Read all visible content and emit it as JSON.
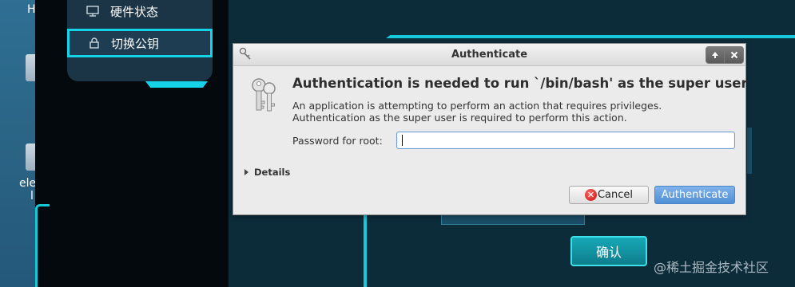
{
  "desktop": {
    "label_h": "H",
    "label_ele": "ele",
    "label_l": "l"
  },
  "sidebar": {
    "items": [
      {
        "label": "硬件状态",
        "icon": "monitor-icon"
      },
      {
        "label": "切换公钥",
        "icon": "lock-icon"
      }
    ]
  },
  "main": {
    "confirm_label": "确认"
  },
  "watermark": "@稀土掘金技术社区",
  "dialog": {
    "title": "Authenticate",
    "heading": "Authentication is needed to run `/bin/bash' as the super user",
    "desc_line1": "An application is attempting to perform an action that requires privileges.",
    "desc_line2": "Authentication as the super user is required to perform this action.",
    "password_label": "Password for root:",
    "password_value": "",
    "details_label": "Details",
    "cancel_label": "Cancel",
    "authenticate_label": "Authenticate"
  },
  "colors": {
    "accent_cyan": "#14d3e6",
    "panel_dark": "#1c3546",
    "auth_button_blue": "#4f8fd6"
  }
}
